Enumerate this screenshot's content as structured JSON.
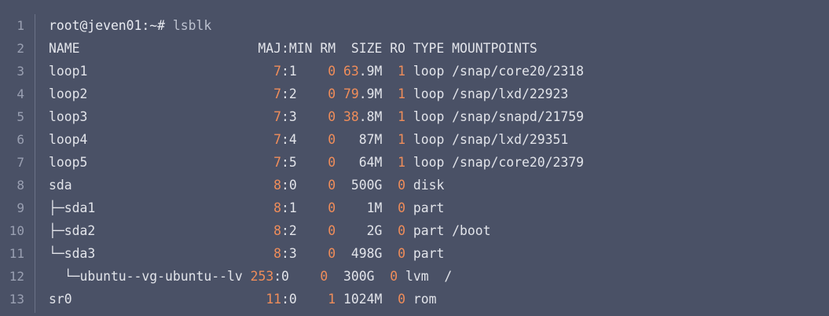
{
  "gutter": {
    "lines": [
      "1",
      "2",
      "3",
      "4",
      "5",
      "6",
      "7",
      "8",
      "9",
      "10",
      "11",
      "12",
      "13"
    ]
  },
  "command": {
    "prompt": "root@jeven01:~#",
    "text": " lsblk"
  },
  "header": {
    "text": "NAME                       MAJ:MIN RM  SIZE RO TYPE MOUNTPOINTS"
  },
  "rows": [
    {
      "name": "loop1                        ",
      "maj": "7",
      "min": ":1    ",
      "rm": "0",
      "size_hi": " 63",
      "size_lo": ".9M  ",
      "ro": "1",
      "rest": " loop /snap/core20/2318"
    },
    {
      "name": "loop2                        ",
      "maj": "7",
      "min": ":2    ",
      "rm": "0",
      "size_hi": " 79",
      "size_lo": ".9M  ",
      "ro": "1",
      "rest": " loop /snap/lxd/22923"
    },
    {
      "name": "loop3                        ",
      "maj": "7",
      "min": ":3    ",
      "rm": "0",
      "size_hi": " 38",
      "size_lo": ".8M  ",
      "ro": "1",
      "rest": " loop /snap/snapd/21759"
    },
    {
      "name": "loop4                        ",
      "maj": "7",
      "min": ":4    ",
      "rm": "0",
      "size_hi": "",
      "size_lo": "   87M  ",
      "ro": "1",
      "rest": " loop /snap/lxd/29351"
    },
    {
      "name": "loop5                        ",
      "maj": "7",
      "min": ":5    ",
      "rm": "0",
      "size_hi": "",
      "size_lo": "   64M  ",
      "ro": "1",
      "rest": " loop /snap/core20/2379"
    },
    {
      "name": "sda                          ",
      "maj": "8",
      "min": ":0    ",
      "rm": "0",
      "size_hi": "",
      "size_lo": "  500G  ",
      "ro": "0",
      "rest": " disk"
    },
    {
      "name": "├─sda1                       ",
      "maj": "8",
      "min": ":1    ",
      "rm": "0",
      "size_hi": "",
      "size_lo": "    1M  ",
      "ro": "0",
      "rest": " part"
    },
    {
      "name": "├─sda2                       ",
      "maj": "8",
      "min": ":2    ",
      "rm": "0",
      "size_hi": "",
      "size_lo": "    2G  ",
      "ro": "0",
      "rest": " part /boot"
    },
    {
      "name": "└─sda3                       ",
      "maj": "8",
      "min": ":3    ",
      "rm": "0",
      "size_hi": "",
      "size_lo": "  498G  ",
      "ro": "0",
      "rest": " part"
    },
    {
      "name": "  └─ubuntu--vg-ubuntu--lv ",
      "maj": "253",
      "min": ":0    ",
      "rm": "0",
      "size_hi": "",
      "size_lo": "  300G  ",
      "ro": "0",
      "rest": " lvm  /"
    },
    {
      "name": "sr0                         ",
      "maj": "11",
      "min": ":0    ",
      "rm": "1",
      "size_hi": "",
      "size_lo": " 1024M  ",
      "ro": "0",
      "rest": " rom"
    }
  ],
  "colors": {
    "background": "#4a5166",
    "number": "#f08d5a",
    "text": "#e2e4ea",
    "line_number": "#9aa0b2"
  }
}
